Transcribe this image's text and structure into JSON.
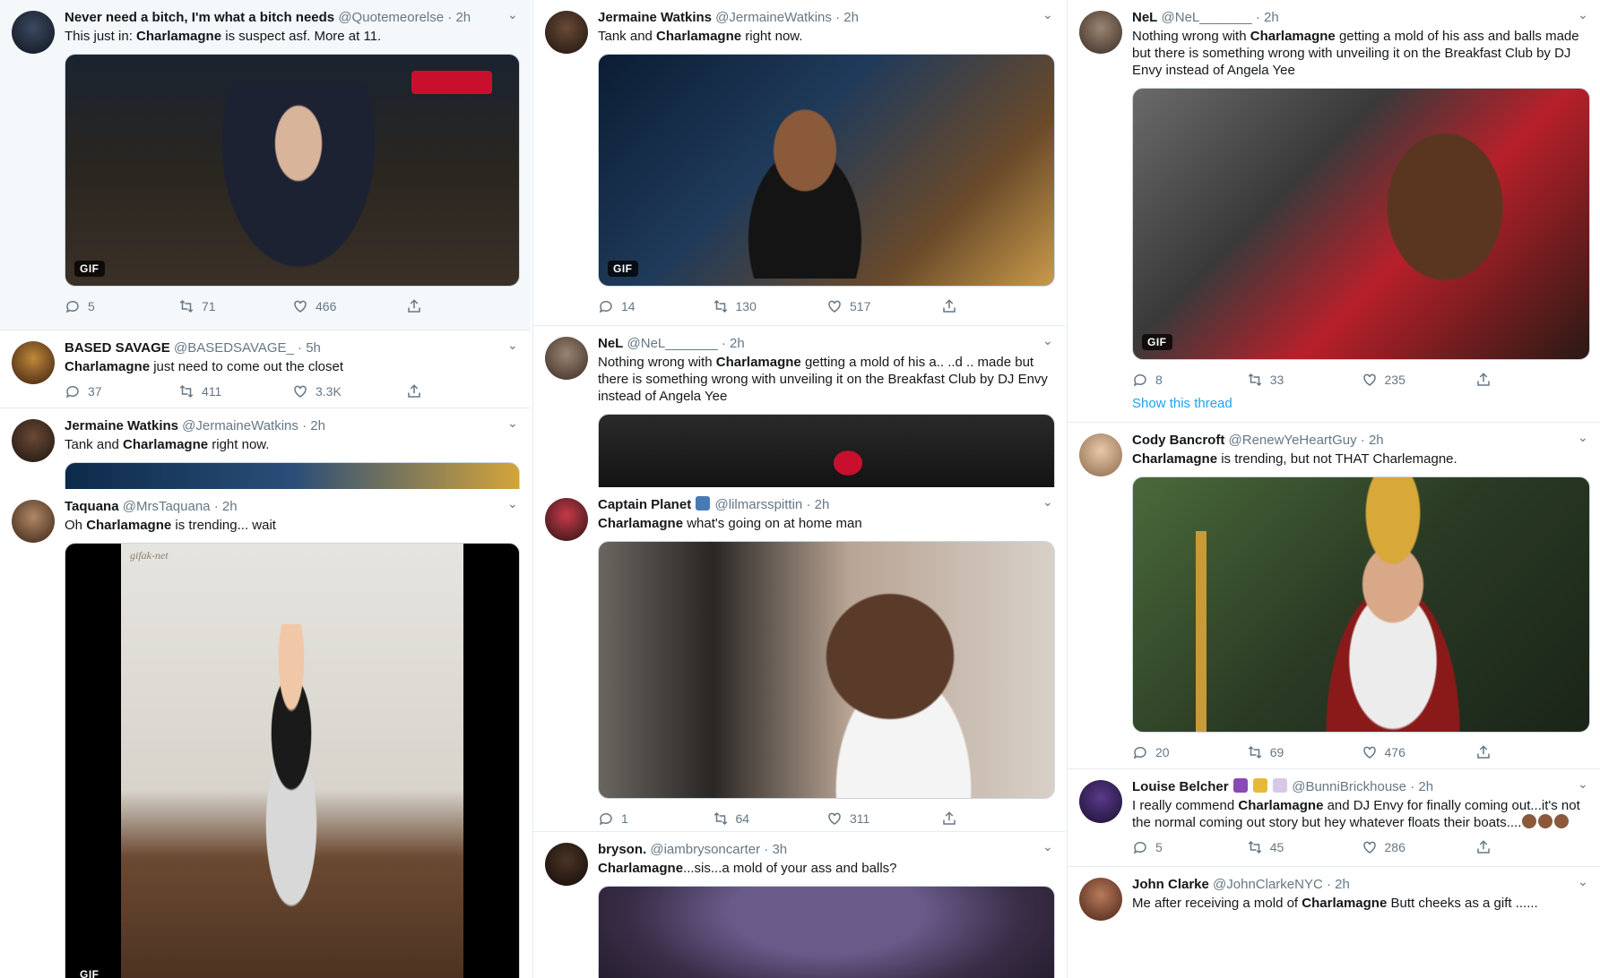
{
  "tweets": [
    {
      "name": "Never need a bitch, I'm what a bitch needs",
      "handle": "@Quotemeorelse",
      "time": "· 2h",
      "pre": "This just in: ",
      "bold": "Charlamagne",
      "post": " is suspect asf. More at 11.",
      "gif": "GIF",
      "replies": "5",
      "retweets": "71",
      "likes": "466"
    },
    {
      "name": "BASED SAVAGE",
      "handle": "@BASEDSAVAGE_",
      "time": "· 5h",
      "pre": "",
      "bold": "Charlamagne",
      "post": " just need to come out the closet",
      "replies": "37",
      "retweets": "411",
      "likes": "3.3K"
    },
    {
      "name": "Jermaine Watkins",
      "handle": "@JermaineWatkins",
      "time": "· 2h",
      "pre": "Tank and ",
      "bold": "Charlamagne",
      "post": " right now."
    },
    {
      "name": "Taquana",
      "handle": "@MrsTaquana",
      "time": "· 2h",
      "pre": "Oh ",
      "bold": "Charlamagne",
      "post": " is trending... wait",
      "watermark": "gifak-net",
      "gif": "GIF"
    },
    {
      "name": "Jermaine Watkins",
      "handle": "@JermaineWatkins",
      "time": "· 2h",
      "pre": "Tank and ",
      "bold": "Charlamagne",
      "post": " right now.",
      "gif": "GIF",
      "replies": "14",
      "retweets": "130",
      "likes": "517"
    },
    {
      "name": "NeL",
      "handle": "@NeL_______",
      "time": "· 2h",
      "pre": "Nothing wrong with ",
      "bold": "Charlamagne",
      "post": " getting a mold of his a.. ..d .. made but there is something wrong with unveiling it on the Breakfast Club by DJ Envy instead of Angela Yee"
    },
    {
      "name": "Captain Planet",
      "handle": "@lilmarsspittin",
      "time": "· 2h",
      "pre": "",
      "bold": "Charlamagne",
      "post": " what's going on at home man",
      "replies": "1",
      "retweets": "64",
      "likes": "311"
    },
    {
      "name": "bryson.",
      "handle": "@iambrysoncarter",
      "time": "· 3h",
      "pre": "",
      "bold": "Charlamagne",
      "post": "...sis...a mold of your ass and balls?"
    },
    {
      "name": "NeL",
      "handle": "@NeL_______",
      "time": "· 2h",
      "pre": "Nothing wrong with ",
      "bold": "Charlamagne",
      "post": " getting a mold of his ass and balls made but there is something wrong with unveiling it on the Breakfast Club by DJ Envy instead of Angela Yee",
      "gif": "GIF",
      "replies": "8",
      "retweets": "33",
      "likes": "235",
      "show_thread": "Show this thread"
    },
    {
      "name": "Cody Bancroft",
      "handle": "@RenewYeHeartGuy",
      "time": "· 2h",
      "pre": "",
      "bold": "Charlamagne",
      "post": " is trending, but not THAT Charlemagne.",
      "replies": "20",
      "retweets": "69",
      "likes": "476"
    },
    {
      "name": "Louise Belcher",
      "handle": "@BunniBrickhouse",
      "time": "· 2h",
      "pre": "I really commend ",
      "bold": "Charlamagne",
      "post": " and DJ Envy for finally coming out...it's not the normal coming out story but hey whatever floats their boats....",
      "replies": "5",
      "retweets": "45",
      "likes": "286"
    },
    {
      "name": "John Clarke",
      "handle": "@JohnClarkeNYC",
      "time": "· 2h",
      "pre": "Me after receiving a mold of ",
      "bold": "Charlamagne",
      "post": "  Butt cheeks as a gift ......"
    }
  ],
  "colors": {
    "accent": "#1da1f2",
    "muted": "#657786",
    "border": "#e6ecf0"
  }
}
